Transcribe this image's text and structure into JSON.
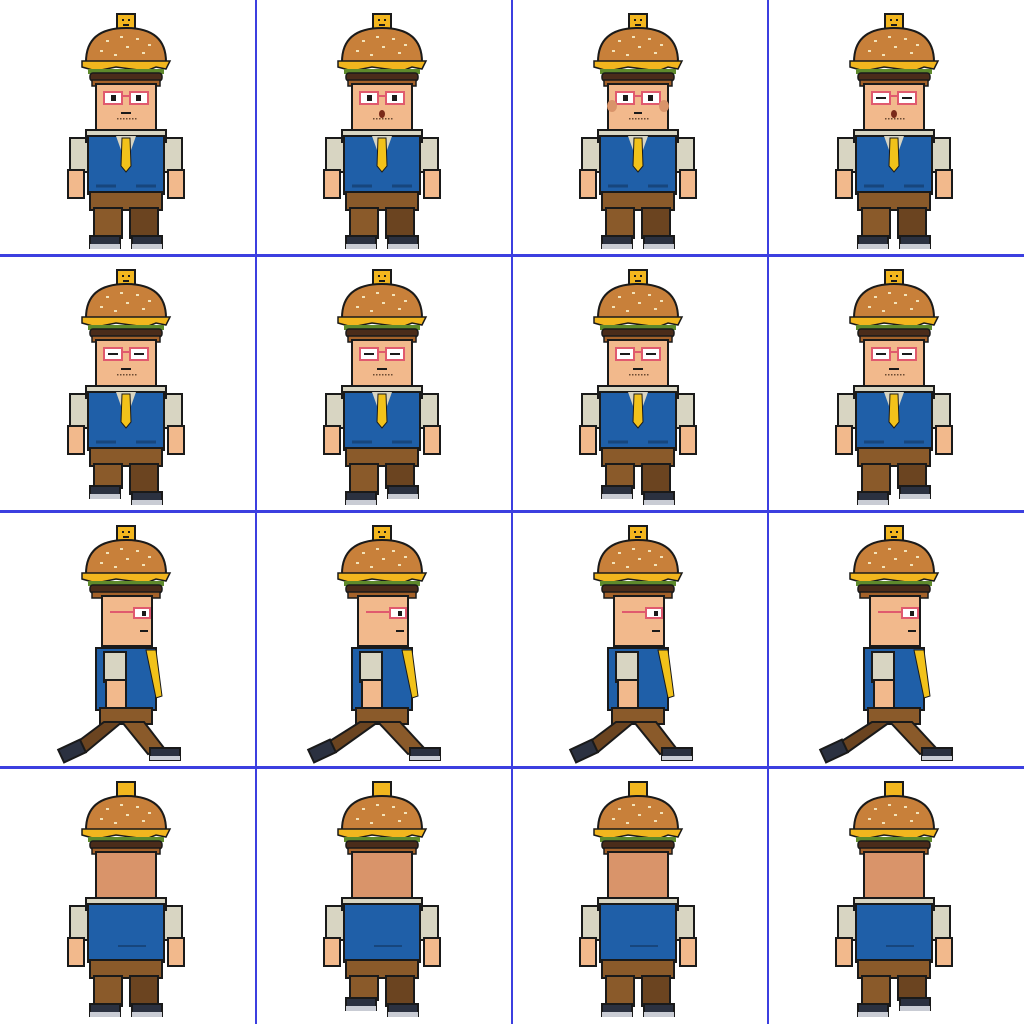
{
  "sheet": {
    "rows": 4,
    "cols": 4,
    "grid_color": "#3c3fe0",
    "background": "#ffffff"
  },
  "palette": {
    "bun": "#c8803a",
    "bun_shade": "#a5622a",
    "sesame": "#f3e2b8",
    "cheese": "#f2b61e",
    "lettuce": "#5e8a2c",
    "patty": "#4a2c1a",
    "skin": "#f2b98c",
    "skin_shade": "#d9946a",
    "shirt": "#d8d5c2",
    "vest": "#1f5fa8",
    "vest_shade": "#17467d",
    "tie": "#f2c21a",
    "pants": "#8a5a2a",
    "pants_shade": "#6b4420",
    "shoe": "#2b3140",
    "sole": "#c9ccd4",
    "glasses": "#e05a6e",
    "outline": "#1a1a1a",
    "sock": "#b83fb8"
  },
  "rows": [
    {
      "direction": "front-idle",
      "frames": [
        {
          "face": "neutral"
        },
        {
          "face": "surprised"
        },
        {
          "face": "cheeks"
        },
        {
          "face": "sleepy"
        }
      ]
    },
    {
      "direction": "front-walk",
      "frames": [
        {
          "face": "squint",
          "step": -1
        },
        {
          "face": "squint",
          "step": 1
        },
        {
          "face": "squint",
          "step": -1
        },
        {
          "face": "squint",
          "step": 1
        }
      ]
    },
    {
      "direction": "side-walk",
      "frames": [
        {
          "step": 1
        },
        {
          "step": 2
        },
        {
          "step": 1
        },
        {
          "step": 2
        }
      ]
    },
    {
      "direction": "back-walk",
      "frames": [
        {
          "step": 0
        },
        {
          "step": -1
        },
        {
          "step": 0
        },
        {
          "step": 1
        }
      ]
    }
  ]
}
